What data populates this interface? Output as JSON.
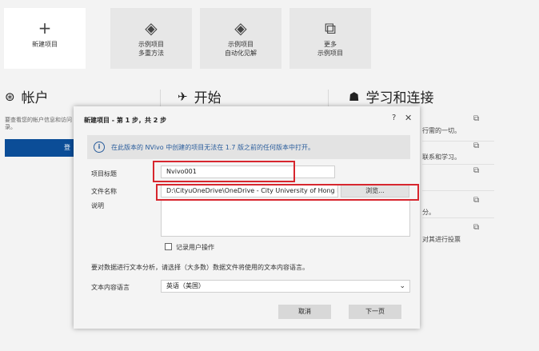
{
  "tiles": [
    {
      "icon": "+",
      "line1": "新建项目",
      "line2": ""
    },
    {
      "icon": "◈",
      "line1": "示例项目",
      "line2": "多重方法"
    },
    {
      "icon": "◈",
      "line1": "示例项目",
      "line2": "自动化见解"
    },
    {
      "icon": "⧉",
      "line1": "更多",
      "line2": "示例项目"
    }
  ],
  "sections": {
    "account": {
      "icon": "⊛",
      "title": "帐户"
    },
    "start": {
      "icon": "✈",
      "title": "开始"
    },
    "learn": {
      "icon": "☗",
      "title": "学习和连接"
    }
  },
  "account": {
    "text": "要查看您的帐户信息和访问录。",
    "button_label": "登"
  },
  "right_items": [
    "行需的一切。",
    "联系和学习。",
    "",
    "分。",
    "对其进行投票"
  ],
  "dialog": {
    "title": "新建项目 - 第 1 步，共 2 步",
    "help": "?",
    "close": "✕",
    "info": "在此版本的 NVivo 中创建的项目无法在 1.7 版之前的任何版本中打开。",
    "project_title_label": "项目标题",
    "project_title_value": "Nvivo001",
    "file_name_label": "文件名称",
    "file_name_value": "D:\\CityuOneDrive\\OneDrive - City University of Hong Kong",
    "browse_label": "浏览...",
    "description_label": "说明",
    "record_label": "记录用户操作",
    "language_note": "要对数据进行文本分析，请选择（大多数）数据文件将使用的文本内容语言。",
    "text_lang_label": "文本内容语言",
    "text_lang_value": "英语（美国）",
    "cancel_label": "取消",
    "next_label": "下一页"
  },
  "colors": {
    "accent": "#0b4d97",
    "highlight": "#d7262e",
    "info_text": "#2a5d9c"
  }
}
